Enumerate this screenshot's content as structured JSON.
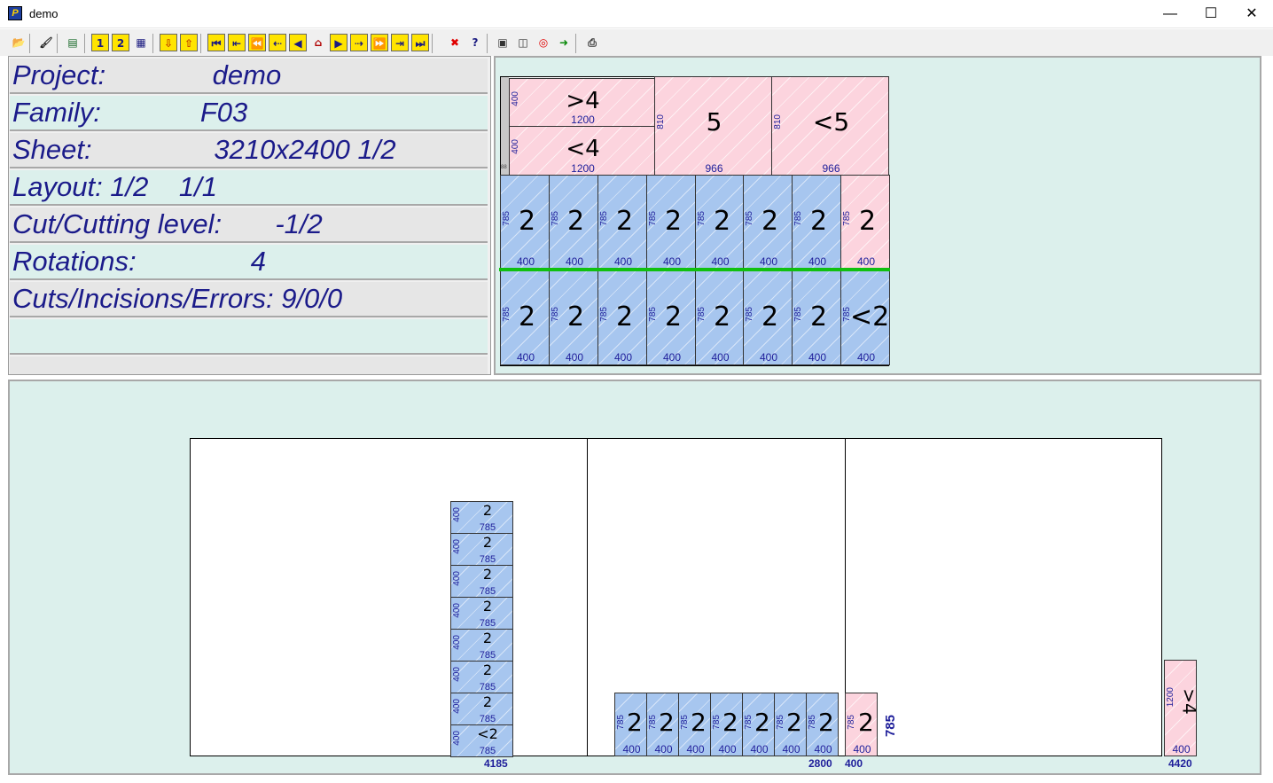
{
  "window": {
    "title": "demo",
    "minimize": "—",
    "maximize": "☐",
    "close": "✕"
  },
  "toolbar": {
    "buttons": [
      {
        "name": "open-folder-icon",
        "glyph": "📂"
      },
      {
        "name": "brush-icon",
        "glyph": "🖌"
      },
      {
        "name": "list-icon",
        "glyph": "▤"
      },
      {
        "name": "view-1-icon",
        "glyph": "1"
      },
      {
        "name": "view-2-icon",
        "glyph": "2"
      },
      {
        "name": "report-icon",
        "glyph": "▦"
      },
      {
        "name": "import-icon",
        "glyph": "⇩"
      },
      {
        "name": "export-icon",
        "glyph": "⇧"
      },
      {
        "name": "first-icon",
        "glyph": "⏮"
      },
      {
        "name": "prev-cut-icon",
        "glyph": "⇤"
      },
      {
        "name": "fast-back-icon",
        "glyph": "⏪"
      },
      {
        "name": "step-back-icon",
        "glyph": "⇠"
      },
      {
        "name": "back-icon",
        "glyph": "◀"
      },
      {
        "name": "home-icon",
        "glyph": "⌂"
      },
      {
        "name": "forward-icon",
        "glyph": "▶"
      },
      {
        "name": "step-forward-icon",
        "glyph": "⇢"
      },
      {
        "name": "fast-forward-icon",
        "glyph": "⏩"
      },
      {
        "name": "next-cut-icon",
        "glyph": "⇥"
      },
      {
        "name": "last-icon",
        "glyph": "⏭"
      },
      {
        "name": "cancel-icon",
        "glyph": "✖"
      },
      {
        "name": "help-icon",
        "glyph": "?"
      },
      {
        "name": "stack-icon",
        "glyph": "▣"
      },
      {
        "name": "sheets-icon",
        "glyph": "◫"
      },
      {
        "name": "lifebuoy-icon",
        "glyph": "◎"
      },
      {
        "name": "go-icon",
        "glyph": "➜"
      },
      {
        "name": "print-icon",
        "glyph": "⎙"
      }
    ]
  },
  "info": {
    "project": "Project:              demo",
    "family": "Family:             F03",
    "sheet": "Sheet:                3210x2400 1/2",
    "layout": "Layout: 1/2    1/1",
    "cut_level": "Cut/Cutting level:       -1/2",
    "rotations": "Rotations:               4",
    "cuts": "Cuts/Incisions/Errors: 9/0/0",
    "empty1": "",
    "empty2": ""
  },
  "sheet_view": {
    "top_pieces": [
      {
        "label": ">4",
        "width": "1200",
        "height": "400"
      },
      {
        "label": "<4",
        "width": "1200",
        "height": "400"
      },
      {
        "label": "5",
        "width": "966",
        "height": "810"
      },
      {
        "label": "<5",
        "width": "966",
        "height": "810"
      }
    ],
    "row1": [
      {
        "label": "2",
        "w": "400",
        "h": "785",
        "color": "blue"
      },
      {
        "label": "2",
        "w": "400",
        "h": "785",
        "color": "blue"
      },
      {
        "label": "2",
        "w": "400",
        "h": "785",
        "color": "blue"
      },
      {
        "label": "2",
        "w": "400",
        "h": "785",
        "color": "blue"
      },
      {
        "label": "2",
        "w": "400",
        "h": "785",
        "color": "blue"
      },
      {
        "label": "2",
        "w": "400",
        "h": "785",
        "color": "blue"
      },
      {
        "label": "2",
        "w": "400",
        "h": "785",
        "color": "blue"
      },
      {
        "label": "2",
        "w": "400",
        "h": "785",
        "color": "pink"
      }
    ],
    "row2": [
      {
        "label": "2",
        "w": "400",
        "h": "785",
        "color": "blue"
      },
      {
        "label": "2",
        "w": "400",
        "h": "785",
        "color": "blue"
      },
      {
        "label": "2",
        "w": "400",
        "h": "785",
        "color": "blue"
      },
      {
        "label": "2",
        "w": "400",
        "h": "785",
        "color": "blue"
      },
      {
        "label": "2",
        "w": "400",
        "h": "785",
        "color": "blue"
      },
      {
        "label": "2",
        "w": "400",
        "h": "785",
        "color": "blue"
      },
      {
        "label": "2",
        "w": "400",
        "h": "785",
        "color": "blue"
      },
      {
        "label": "<2",
        "w": "400",
        "h": "785",
        "color": "blue"
      }
    ],
    "edge_mark": "88"
  },
  "layout_view": {
    "stack": [
      {
        "label": "2",
        "w": "400",
        "h": "785"
      },
      {
        "label": "2",
        "w": "400",
        "h": "785"
      },
      {
        "label": "2",
        "w": "400",
        "h": "785"
      },
      {
        "label": "2",
        "w": "400",
        "h": "785"
      },
      {
        "label": "2",
        "w": "400",
        "h": "785"
      },
      {
        "label": "2",
        "w": "400",
        "h": "785"
      },
      {
        "label": "2",
        "w": "400",
        "h": "785"
      },
      {
        "label": "<2",
        "w": "400",
        "h": "785"
      }
    ],
    "row": [
      {
        "label": "2",
        "w": "400",
        "h": "785"
      },
      {
        "label": "2",
        "w": "400",
        "h": "785"
      },
      {
        "label": "2",
        "w": "400",
        "h": "785"
      },
      {
        "label": "2",
        "w": "400",
        "h": "785"
      },
      {
        "label": "2",
        "w": "400",
        "h": "785"
      },
      {
        "label": "2",
        "w": "400",
        "h": "785"
      },
      {
        "label": "2",
        "w": "400",
        "h": "785"
      }
    ],
    "pink_piece": {
      "label": "2",
      "w": "400",
      "h": "785"
    },
    "side_piece": {
      "label": ">4",
      "w": "400",
      "h": "1200"
    },
    "dimension_785": "785",
    "dims": {
      "d1": "4185",
      "d2": "2800",
      "d3": "400",
      "d4": "4420"
    }
  },
  "colors": {
    "blue_piece": "#a7c6ef",
    "pink_piece": "#fcd4de",
    "panel_bg": "#dcf0ec",
    "text_navy": "#1b1b8a",
    "cut_line": "#10c010",
    "marker": "#ff0000"
  }
}
